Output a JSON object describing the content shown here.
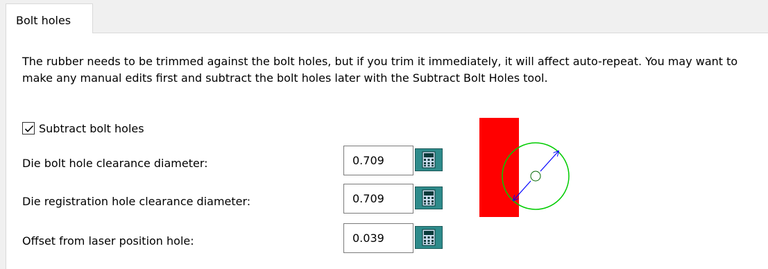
{
  "tab": {
    "label": "Bolt holes"
  },
  "description": "The rubber needs to be trimmed against the bolt holes, but if you trim it immediately, it will affect auto-repeat. You may want to make any manual edits first and subtract the bolt holes later with the Subtract Bolt Holes tool.",
  "subtract": {
    "label": "Subtract bolt holes",
    "checked": true
  },
  "fields": [
    {
      "label": "Die bolt hole clearance diameter:",
      "value": "0.709"
    },
    {
      "label": "Die registration hole clearance diameter:",
      "value": "0.709"
    },
    {
      "label": "Offset from laser position hole:",
      "value": "0.039"
    }
  ],
  "colors": {
    "rubber": "#ff0000",
    "hole_circle": "#00cc00",
    "diameter_arrow": "#0000ff",
    "calculator_button": "#2e8b8b"
  },
  "icons": {
    "calculator": "calculator-icon",
    "checkmark": "checkmark-icon"
  }
}
